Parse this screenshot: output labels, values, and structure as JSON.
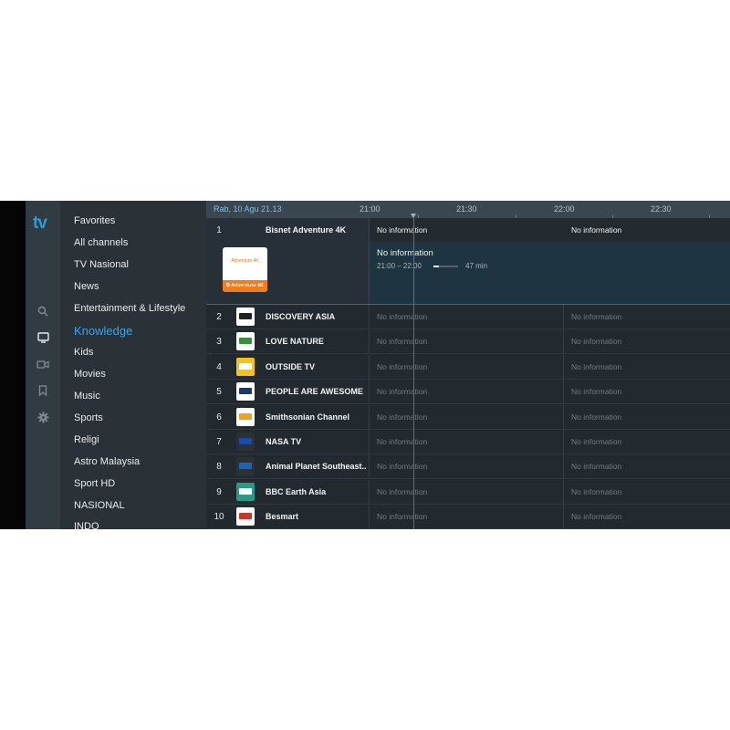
{
  "app": {
    "logo": "tv"
  },
  "rail": {
    "icons": [
      "search-icon",
      "tv-icon",
      "video-camera-icon",
      "bookmark-icon",
      "gear-icon"
    ]
  },
  "categories": [
    "Favorites",
    "All channels",
    "TV Nasional",
    "News",
    "Entertainment & Lifestyle",
    "Knowledge",
    "Kids",
    "Movies",
    "Music",
    "Sports",
    "Religi",
    "Astro Malaysia",
    "Sport HD",
    "NASIONAL",
    "INDO"
  ],
  "active_category": "Knowledge",
  "timeline": {
    "date": "Rab, 10 Agu 21.13",
    "times": [
      "21:00",
      "21:30",
      "22:00",
      "22:30"
    ]
  },
  "selected": {
    "number": "1",
    "name": "Bisnet Adventure 4K",
    "logo_top": "Adventure 4K",
    "logo_bottom": "B Adventure 4K",
    "program_now": "No information",
    "program_next": "No information",
    "detail_title": "No information",
    "detail_time": "21:00 – 22:00",
    "detail_remaining": "47 min",
    "progress": 0.22
  },
  "channels": [
    {
      "number": "2",
      "name": "DISCOVERY ASIA",
      "logo": "discovery-asia-logo",
      "p1": "No information",
      "p2": "No information"
    },
    {
      "number": "3",
      "name": "LOVE NATURE",
      "logo": "love-nature-logo",
      "p1": "No information",
      "p2": "No information"
    },
    {
      "number": "4",
      "name": "OUTSIDE TV",
      "logo": "outside-tv-logo",
      "p1": "No information",
      "p2": "No information"
    },
    {
      "number": "5",
      "name": "PEOPLE ARE AWESOME",
      "logo": "people-are-awesome-logo",
      "p1": "No information",
      "p2": "No information"
    },
    {
      "number": "6",
      "name": "Smithsonian Channel",
      "logo": "smithsonian-logo",
      "p1": "No information",
      "p2": "No information"
    },
    {
      "number": "7",
      "name": "NASA TV",
      "logo": "nasa-logo",
      "p1": "No information",
      "p2": "No information"
    },
    {
      "number": "8",
      "name": "Animal Planet Southeast...",
      "logo": "animal-planet-logo",
      "p1": "No information",
      "p2": "No information"
    },
    {
      "number": "9",
      "name": "BBC Earth Asia",
      "logo": "bbc-earth-logo",
      "p1": "No information",
      "p2": "No information"
    },
    {
      "number": "10",
      "name": "Besmart",
      "logo": "besmart-logo",
      "p1": "No information",
      "p2": "No information"
    }
  ],
  "colors": {
    "accent": "#3ba3ea",
    "background": "#2b3237",
    "timeline": "#3a4650"
  }
}
